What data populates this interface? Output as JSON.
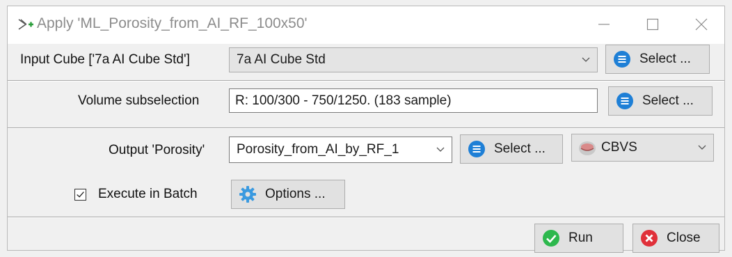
{
  "window": {
    "title": "Apply 'ML_Porosity_from_AI_RF_100x50'"
  },
  "input_cube": {
    "label": "Input Cube ['7a AI Cube Std']",
    "selected": "7a AI Cube Std",
    "select_button": "Select ..."
  },
  "volume": {
    "label": "Volume subselection",
    "value": "R: 100/300 - 750/1250.  (183 sample)",
    "select_button": "Select ..."
  },
  "output": {
    "label": "Output 'Porosity'",
    "selected": "Porosity_from_AI_by_RF_1",
    "select_button": "Select ...",
    "format": "CBVS"
  },
  "batch": {
    "label": "Execute in Batch",
    "checked": true,
    "options_button": "Options ..."
  },
  "footer": {
    "run_button": "Run",
    "close_button": "Close"
  },
  "colors": {
    "select_icon": "#1e7fd6",
    "run_icon": "#2db84d",
    "close_icon": "#e0303a",
    "gear_icon": "#3a9ae0"
  }
}
